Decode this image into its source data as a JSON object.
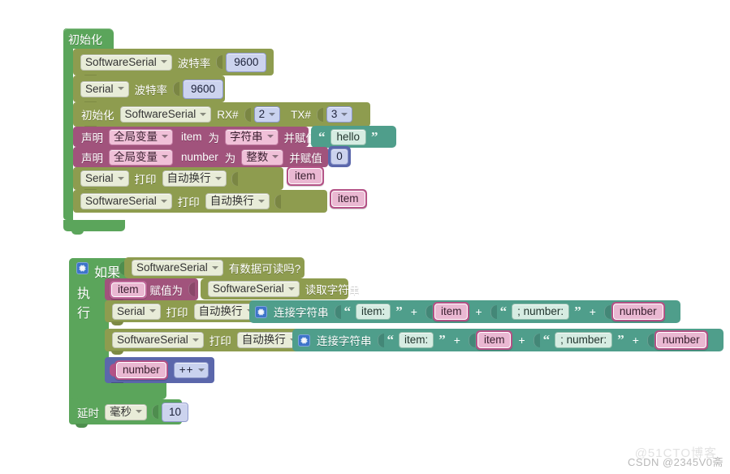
{
  "app": {
    "kind": "blockly-visual-programming-canvas",
    "language": "zh-CN"
  },
  "watermark": {
    "front": "CSDN @2345V0斋",
    "back": "@51CTO博客"
  },
  "icons": {
    "gear": "gear-icon",
    "caret": "chevron-down-icon"
  },
  "group_setup": {
    "hat_label": "初始化",
    "rows": [
      {
        "id": "softwareserial-baud",
        "port": "SoftwareSerial",
        "label": "波特率",
        "value": "9600"
      },
      {
        "id": "serial-baud",
        "port": "Serial",
        "label": "波特率",
        "value": "9600"
      },
      {
        "id": "softwareserial-init",
        "prefix": "初始化",
        "port": "SoftwareSerial",
        "rx_label": "RX#",
        "rx_value": "2",
        "tx_label": "TX#",
        "tx_value": "3"
      },
      {
        "id": "declare-item",
        "declare": "声明",
        "scope": "全局变量",
        "name": "item",
        "as": "为",
        "type": "字符串",
        "assign": "并赋值",
        "string_value": "hello"
      },
      {
        "id": "declare-number",
        "declare": "声明",
        "scope": "全局变量",
        "name": "number",
        "as": "为",
        "type": "整数",
        "assign": "并赋值",
        "number_value": "0"
      },
      {
        "id": "serial-print-item",
        "port": "Serial",
        "print_label": "打印",
        "mode": "自动换行",
        "arg": "item"
      },
      {
        "id": "softwareserial-print-item",
        "port": "SoftwareSerial",
        "print_label": "打印",
        "mode": "自动换行",
        "arg": "item"
      }
    ]
  },
  "group_loop": {
    "if_label": "如果",
    "do_label": "执行",
    "condition": {
      "port": "SoftwareSerial",
      "text": "有数据可读吗?"
    },
    "rows": [
      {
        "id": "set-item",
        "var": "item",
        "set_label": "赋值为",
        "port": "SoftwareSerial",
        "action": "读取字符串"
      },
      {
        "id": "serial-print-concat",
        "port": "Serial",
        "print_label": "打印",
        "mode": "自动换行",
        "concat_label": "连接字符串",
        "parts": [
          "item: ",
          "item",
          "; number: ",
          "number"
        ],
        "operator": "+"
      },
      {
        "id": "softwareserial-print-concat",
        "port": "SoftwareSerial",
        "print_label": "打印",
        "mode": "自动换行",
        "concat_label": "连接字符串",
        "parts": [
          "item: ",
          "item",
          "; number: ",
          "number"
        ],
        "operator": "+"
      },
      {
        "id": "number-increment",
        "var": "number",
        "op": "++"
      }
    ],
    "delay": {
      "label": "延时",
      "unit": "毫秒",
      "value": "10"
    }
  },
  "colors": {
    "event_green": "#5ba55b",
    "serial_olive": "#8e9c4f",
    "variable_mauve": "#a1537c",
    "string_teal": "#4f9e8b",
    "math_blue": "#5b67ab",
    "var_pink": "#b45286",
    "gear_blue": "#3d74c9"
  }
}
